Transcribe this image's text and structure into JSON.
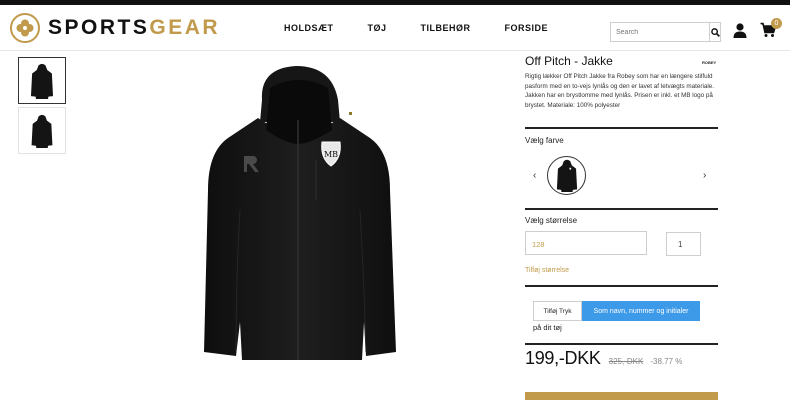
{
  "header": {
    "logo_text_a": "SPORTS",
    "logo_text_b": "GEAR",
    "nav": [
      "HOLDSÆT",
      "TØJ",
      "TILBEHØR",
      "FORSIDE"
    ],
    "search_placeholder": "Search",
    "cart_count": "0",
    "icons": [
      "search-icon",
      "user-icon",
      "cart-icon",
      "clover-logo-icon"
    ]
  },
  "product": {
    "title": "Off Pitch - Jakke",
    "brand": "ROBEY",
    "description": "Rigtig lækker Off Pitch Jakke fra Robey som har en længere stilfuld pasform med en to-vejs lynlås og den er lavet af letvægts materiale. Jakken har en brystlomme med lynlås. Prisen er inkl. et MB logo på brystet. Materiale: 100% polyester",
    "choose_color_label": "Vælg farve",
    "choose_size_label": "Vælg størrelse",
    "size_value": "128",
    "quantity": "1",
    "add_size_link": "Tilføj størrelse",
    "print_button": "Tilføj Tryk",
    "print_option": "Som navn, nummer og initialer",
    "print_note": "på dit tøj",
    "price": "199,-DKK",
    "old_price": "325,-DKK",
    "discount": "-38.77 %"
  },
  "colors": {
    "accent": "#c19a4b",
    "option_blue": "#3d9ae8"
  }
}
